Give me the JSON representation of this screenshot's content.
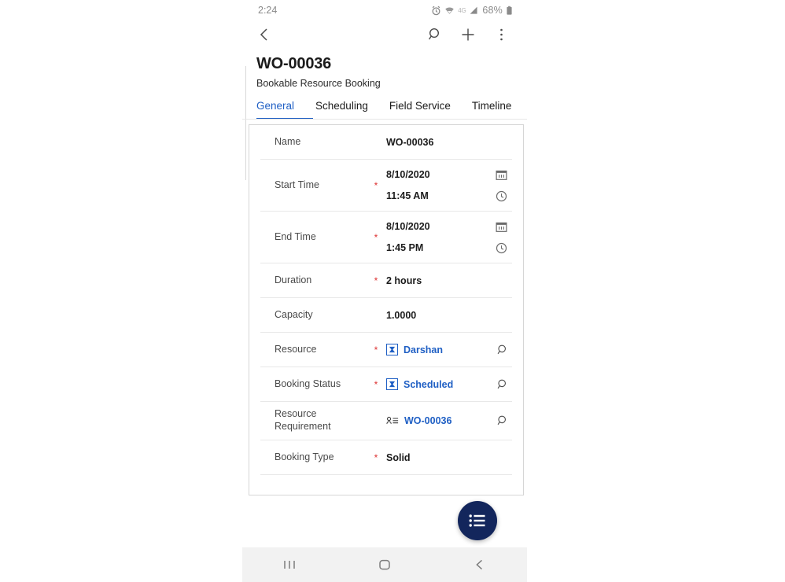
{
  "status_bar": {
    "time": "2:24",
    "battery_percent": "68%",
    "network": "4G",
    "icons": [
      "alarm-icon",
      "wifi-icon",
      "network-4g-icon",
      "signal-icon",
      "battery-icon"
    ]
  },
  "toolbar": {
    "back_icon": "chevron-left-icon",
    "search_icon": "search-icon",
    "add_icon": "plus-icon",
    "more_icon": "overflow-menu-icon"
  },
  "record": {
    "title": "WO-00036",
    "entity": "Bookable Resource Booking"
  },
  "tabs": [
    {
      "label": "General",
      "active": true
    },
    {
      "label": "Scheduling",
      "active": false
    },
    {
      "label": "Field Service",
      "active": false
    },
    {
      "label": "Timeline",
      "active": false
    }
  ],
  "form": {
    "fields": [
      {
        "label": "Name",
        "required": false,
        "value": "WO-00036"
      },
      {
        "label": "Start Time",
        "required": true,
        "date": "8/10/2020",
        "time": "11:45 AM"
      },
      {
        "label": "End Time",
        "required": true,
        "date": "8/10/2020",
        "time": "1:45 PM"
      },
      {
        "label": "Duration",
        "required": true,
        "value": "2 hours"
      },
      {
        "label": "Capacity",
        "required": false,
        "value": "1.0000"
      },
      {
        "label": "Resource",
        "required": true,
        "value": "Darshan"
      },
      {
        "label": "Booking Status",
        "required": true,
        "value": "Scheduled"
      },
      {
        "label": "Resource Requirement",
        "required": false,
        "value": "WO-00036"
      },
      {
        "label": "Booking Type",
        "required": true,
        "value": "Solid"
      }
    ],
    "required_marker": "*"
  },
  "fab": {
    "icon": "list-menu-icon"
  },
  "nav_bar": {
    "recents_icon": "recents-icon",
    "home_icon": "home-icon",
    "back_icon": "back-icon"
  },
  "colors": {
    "accent": "#1f5fc4",
    "fab": "#13265c",
    "required": "#d33333",
    "label": "#4a4a4a"
  }
}
